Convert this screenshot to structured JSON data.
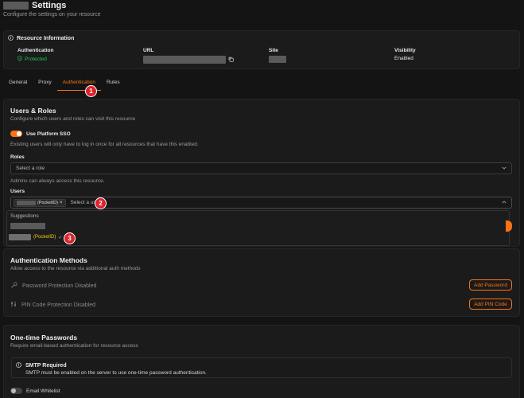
{
  "header": {
    "title": "Settings",
    "subtitle": "Configure the settings on your resource"
  },
  "resource_info": {
    "title": "Resource Information",
    "authentication": {
      "label": "Authentication",
      "value": "Protected"
    },
    "url": {
      "label": "URL"
    },
    "site": {
      "label": "Site"
    },
    "visibility": {
      "label": "Visibility",
      "value": "Enabled"
    }
  },
  "tabs": [
    {
      "label": "General"
    },
    {
      "label": "Proxy"
    },
    {
      "label": "Authentication",
      "active": true
    },
    {
      "label": "Rules"
    }
  ],
  "users_roles": {
    "title": "Users & Roles",
    "subtitle": "Configure which users and roles can visit this resource",
    "sso": {
      "label": "Use Platform SSO",
      "help": "Existing users will only have to log in once for all resources that have this enabled.",
      "enabled": true
    },
    "roles": {
      "label": "Roles",
      "placeholder": "Select a role",
      "help": "Admins can always access this resource."
    },
    "users": {
      "label": "Users",
      "chip_suffix": "(PocketID)",
      "chip_remove": "×",
      "placeholder": "Select a user"
    }
  },
  "suggestions": {
    "title": "Suggestions",
    "item_suffix": "(PocketID)",
    "check": "✓"
  },
  "badges": {
    "one": "1",
    "two": "2",
    "three": "3"
  },
  "auth_methods": {
    "title": "Authentication Methods",
    "subtitle": "Allow access to the resource via additional auth methods",
    "password": {
      "label": "Password Protection Disabled",
      "button": "Add Password"
    },
    "pincode": {
      "label": "PIN Code Protection Disabled",
      "button": "Add PIN Code"
    }
  },
  "otp": {
    "title": "One-time Passwords",
    "subtitle": "Require email-based authentication for resource access",
    "smtp_title": "SMTP Required",
    "smtp_text": "SMTP must be enabled on the server to use one-time password authentication.",
    "whitelist_label": "Email Whitelist"
  },
  "colors": {
    "accent": "#f97316",
    "success": "#22c55e",
    "badge": "#d9232d",
    "background": "#141414"
  }
}
